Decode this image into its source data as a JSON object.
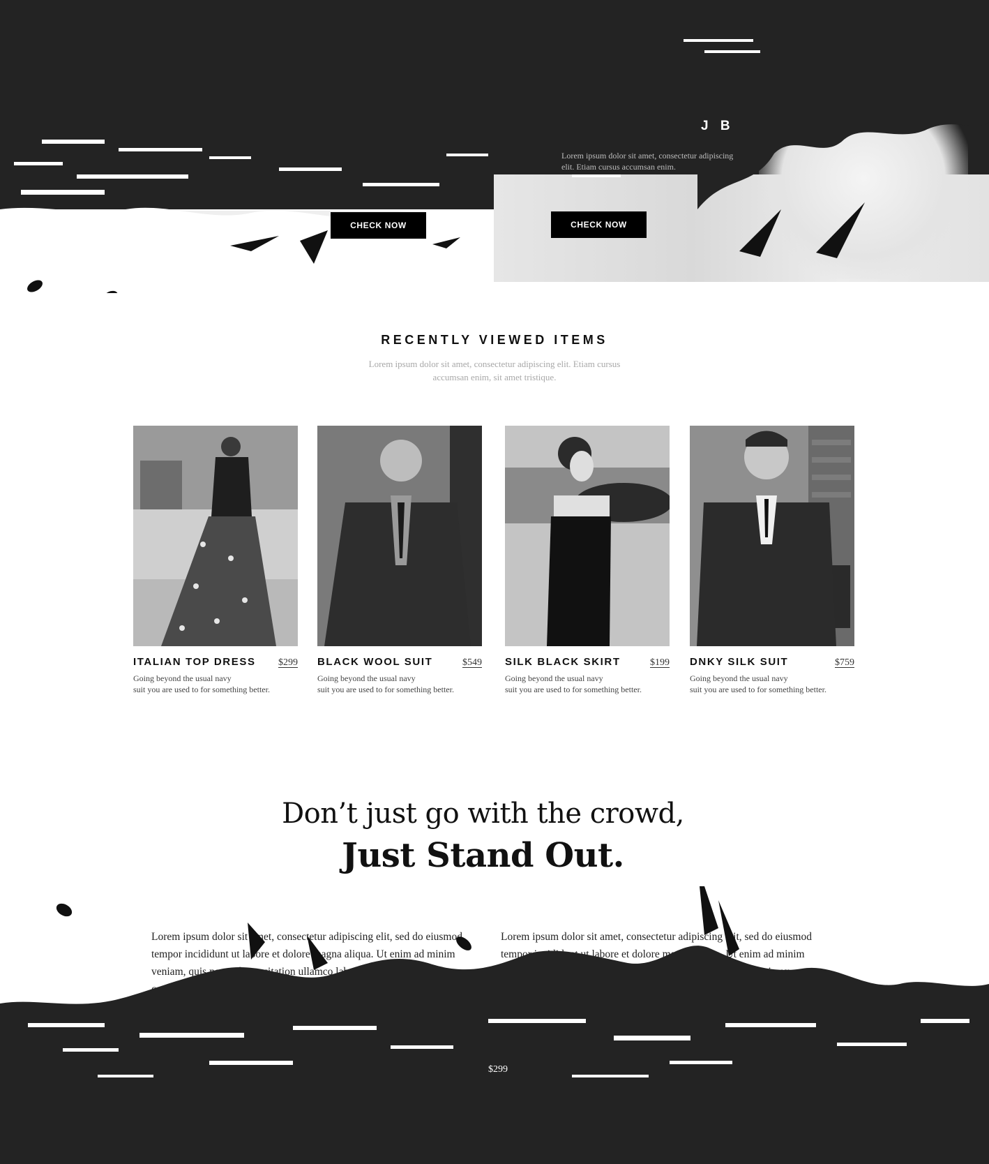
{
  "hero": {
    "brand_title": "J B",
    "description": "Lorem ipsum dolor sit amet, consectetur adipiscing elit. Etiam cursus accumsan enim.",
    "left_button_label": "CHECK NOW",
    "right_button_label": "CHECK NOW"
  },
  "recently_viewed": {
    "title": "RECENTLY VIEWED ITEMS",
    "subtitle_line1": "Lorem ipsum dolor sit amet, consectetur adipiscing elit. Etiam cursus",
    "subtitle_line2": "accumsan enim, sit amet tristique.",
    "products": [
      {
        "name": "ITALIAN TOP DRESS",
        "price": "$299",
        "desc_line1": "Going beyond the usual navy",
        "desc_line2": "suit you are used to for something better."
      },
      {
        "name": "BLACK WOOL SUIT",
        "price": "$549",
        "desc_line1": "Going beyond the usual navy",
        "desc_line2": "suit you are used to for something better."
      },
      {
        "name": "SILK BLACK SKIRT",
        "price": "$199",
        "desc_line1": "Going beyond the usual navy",
        "desc_line2": "suit you are used to for something better."
      },
      {
        "name": "DNKY SILK SUIT",
        "price": "$759",
        "desc_line1": "Going beyond the usual navy",
        "desc_line2": "suit you are used to for something better."
      }
    ]
  },
  "tagline": {
    "line1": "Don’t just go with the crowd,",
    "line2": "Just Stand Out."
  },
  "body": {
    "left_paragraph": "Lorem ipsum dolor sit amet, consectetur adipiscing elit, sed do eiusmod tempor incididunt ut labore et dolore magna aliqua. Ut enim ad minim veniam, quis nostrud exercitation ullamco laboris nisi ut aliquip ex ea commodo consequat. Duis aute irure dolor in reprehenderit in voluptate.",
    "right_paragraph": "Lorem ipsum dolor sit amet, consectetur adipiscing elit, sed do eiusmod tempor incididunt ut labore et dolore magna aliqua. Ut enim ad minim veniam, quis nostrud exercitation ullamco laboris nisi ut aliquip ex ea commodo consequat. Duis aute irure dolor in reprehenderit in voluptate."
  },
  "footer": {
    "price": "$299"
  },
  "colors": {
    "dark_band": "#232323",
    "button_bg": "#000000",
    "text_primary": "#111111",
    "text_muted": "#a8a8a8"
  }
}
